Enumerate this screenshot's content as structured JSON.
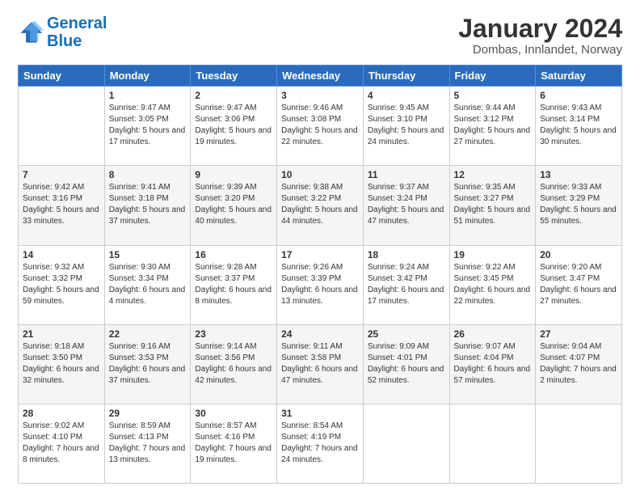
{
  "logo": {
    "line1": "General",
    "line2": "Blue"
  },
  "header": {
    "title": "January 2024",
    "subtitle": "Dombas, Innlandet, Norway"
  },
  "weekdays": [
    "Sunday",
    "Monday",
    "Tuesday",
    "Wednesday",
    "Thursday",
    "Friday",
    "Saturday"
  ],
  "weeks": [
    [
      {
        "day": "",
        "sunrise": "",
        "sunset": "",
        "daylight": ""
      },
      {
        "day": "1",
        "sunrise": "Sunrise: 9:47 AM",
        "sunset": "Sunset: 3:05 PM",
        "daylight": "Daylight: 5 hours and 17 minutes."
      },
      {
        "day": "2",
        "sunrise": "Sunrise: 9:47 AM",
        "sunset": "Sunset: 3:06 PM",
        "daylight": "Daylight: 5 hours and 19 minutes."
      },
      {
        "day": "3",
        "sunrise": "Sunrise: 9:46 AM",
        "sunset": "Sunset: 3:08 PM",
        "daylight": "Daylight: 5 hours and 22 minutes."
      },
      {
        "day": "4",
        "sunrise": "Sunrise: 9:45 AM",
        "sunset": "Sunset: 3:10 PM",
        "daylight": "Daylight: 5 hours and 24 minutes."
      },
      {
        "day": "5",
        "sunrise": "Sunrise: 9:44 AM",
        "sunset": "Sunset: 3:12 PM",
        "daylight": "Daylight: 5 hours and 27 minutes."
      },
      {
        "day": "6",
        "sunrise": "Sunrise: 9:43 AM",
        "sunset": "Sunset: 3:14 PM",
        "daylight": "Daylight: 5 hours and 30 minutes."
      }
    ],
    [
      {
        "day": "7",
        "sunrise": "Sunrise: 9:42 AM",
        "sunset": "Sunset: 3:16 PM",
        "daylight": "Daylight: 5 hours and 33 minutes."
      },
      {
        "day": "8",
        "sunrise": "Sunrise: 9:41 AM",
        "sunset": "Sunset: 3:18 PM",
        "daylight": "Daylight: 5 hours and 37 minutes."
      },
      {
        "day": "9",
        "sunrise": "Sunrise: 9:39 AM",
        "sunset": "Sunset: 3:20 PM",
        "daylight": "Daylight: 5 hours and 40 minutes."
      },
      {
        "day": "10",
        "sunrise": "Sunrise: 9:38 AM",
        "sunset": "Sunset: 3:22 PM",
        "daylight": "Daylight: 5 hours and 44 minutes."
      },
      {
        "day": "11",
        "sunrise": "Sunrise: 9:37 AM",
        "sunset": "Sunset: 3:24 PM",
        "daylight": "Daylight: 5 hours and 47 minutes."
      },
      {
        "day": "12",
        "sunrise": "Sunrise: 9:35 AM",
        "sunset": "Sunset: 3:27 PM",
        "daylight": "Daylight: 5 hours and 51 minutes."
      },
      {
        "day": "13",
        "sunrise": "Sunrise: 9:33 AM",
        "sunset": "Sunset: 3:29 PM",
        "daylight": "Daylight: 5 hours and 55 minutes."
      }
    ],
    [
      {
        "day": "14",
        "sunrise": "Sunrise: 9:32 AM",
        "sunset": "Sunset: 3:32 PM",
        "daylight": "Daylight: 5 hours and 59 minutes."
      },
      {
        "day": "15",
        "sunrise": "Sunrise: 9:30 AM",
        "sunset": "Sunset: 3:34 PM",
        "daylight": "Daylight: 6 hours and 4 minutes."
      },
      {
        "day": "16",
        "sunrise": "Sunrise: 9:28 AM",
        "sunset": "Sunset: 3:37 PM",
        "daylight": "Daylight: 6 hours and 8 minutes."
      },
      {
        "day": "17",
        "sunrise": "Sunrise: 9:26 AM",
        "sunset": "Sunset: 3:39 PM",
        "daylight": "Daylight: 6 hours and 13 minutes."
      },
      {
        "day": "18",
        "sunrise": "Sunrise: 9:24 AM",
        "sunset": "Sunset: 3:42 PM",
        "daylight": "Daylight: 6 hours and 17 minutes."
      },
      {
        "day": "19",
        "sunrise": "Sunrise: 9:22 AM",
        "sunset": "Sunset: 3:45 PM",
        "daylight": "Daylight: 6 hours and 22 minutes."
      },
      {
        "day": "20",
        "sunrise": "Sunrise: 9:20 AM",
        "sunset": "Sunset: 3:47 PM",
        "daylight": "Daylight: 6 hours and 27 minutes."
      }
    ],
    [
      {
        "day": "21",
        "sunrise": "Sunrise: 9:18 AM",
        "sunset": "Sunset: 3:50 PM",
        "daylight": "Daylight: 6 hours and 32 minutes."
      },
      {
        "day": "22",
        "sunrise": "Sunrise: 9:16 AM",
        "sunset": "Sunset: 3:53 PM",
        "daylight": "Daylight: 6 hours and 37 minutes."
      },
      {
        "day": "23",
        "sunrise": "Sunrise: 9:14 AM",
        "sunset": "Sunset: 3:56 PM",
        "daylight": "Daylight: 6 hours and 42 minutes."
      },
      {
        "day": "24",
        "sunrise": "Sunrise: 9:11 AM",
        "sunset": "Sunset: 3:58 PM",
        "daylight": "Daylight: 6 hours and 47 minutes."
      },
      {
        "day": "25",
        "sunrise": "Sunrise: 9:09 AM",
        "sunset": "Sunset: 4:01 PM",
        "daylight": "Daylight: 6 hours and 52 minutes."
      },
      {
        "day": "26",
        "sunrise": "Sunrise: 9:07 AM",
        "sunset": "Sunset: 4:04 PM",
        "daylight": "Daylight: 6 hours and 57 minutes."
      },
      {
        "day": "27",
        "sunrise": "Sunrise: 9:04 AM",
        "sunset": "Sunset: 4:07 PM",
        "daylight": "Daylight: 7 hours and 2 minutes."
      }
    ],
    [
      {
        "day": "28",
        "sunrise": "Sunrise: 9:02 AM",
        "sunset": "Sunset: 4:10 PM",
        "daylight": "Daylight: 7 hours and 8 minutes."
      },
      {
        "day": "29",
        "sunrise": "Sunrise: 8:59 AM",
        "sunset": "Sunset: 4:13 PM",
        "daylight": "Daylight: 7 hours and 13 minutes."
      },
      {
        "day": "30",
        "sunrise": "Sunrise: 8:57 AM",
        "sunset": "Sunset: 4:16 PM",
        "daylight": "Daylight: 7 hours and 19 minutes."
      },
      {
        "day": "31",
        "sunrise": "Sunrise: 8:54 AM",
        "sunset": "Sunset: 4:19 PM",
        "daylight": "Daylight: 7 hours and 24 minutes."
      },
      {
        "day": "",
        "sunrise": "",
        "sunset": "",
        "daylight": ""
      },
      {
        "day": "",
        "sunrise": "",
        "sunset": "",
        "daylight": ""
      },
      {
        "day": "",
        "sunrise": "",
        "sunset": "",
        "daylight": ""
      }
    ]
  ]
}
